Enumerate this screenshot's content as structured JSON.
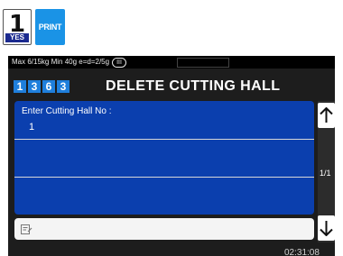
{
  "keys": {
    "yes_digit": "1",
    "yes_label": "YES",
    "print_label": "PRINT"
  },
  "status": {
    "text": "Max 6/15kg Min 40g e=d=2/5g",
    "accuracy_class": "III"
  },
  "header": {
    "menu_code": [
      "1",
      "3",
      "6",
      "3"
    ],
    "title": "DELETE CUTTING HALL"
  },
  "form": {
    "label": "Enter Cutting Hall No :",
    "value": "1"
  },
  "pagination": {
    "indicator": "1/1"
  },
  "clock": {
    "time": "02:31:08"
  },
  "icons": {
    "up": "arrow-up-icon",
    "down": "arrow-down-icon",
    "keyboard": "edit-note-icon"
  },
  "colors": {
    "panel": "#0b3fae",
    "menu_code": "#1f7fdc",
    "print_key": "#1a93e6",
    "screen_bg": "#1d1d1d"
  }
}
